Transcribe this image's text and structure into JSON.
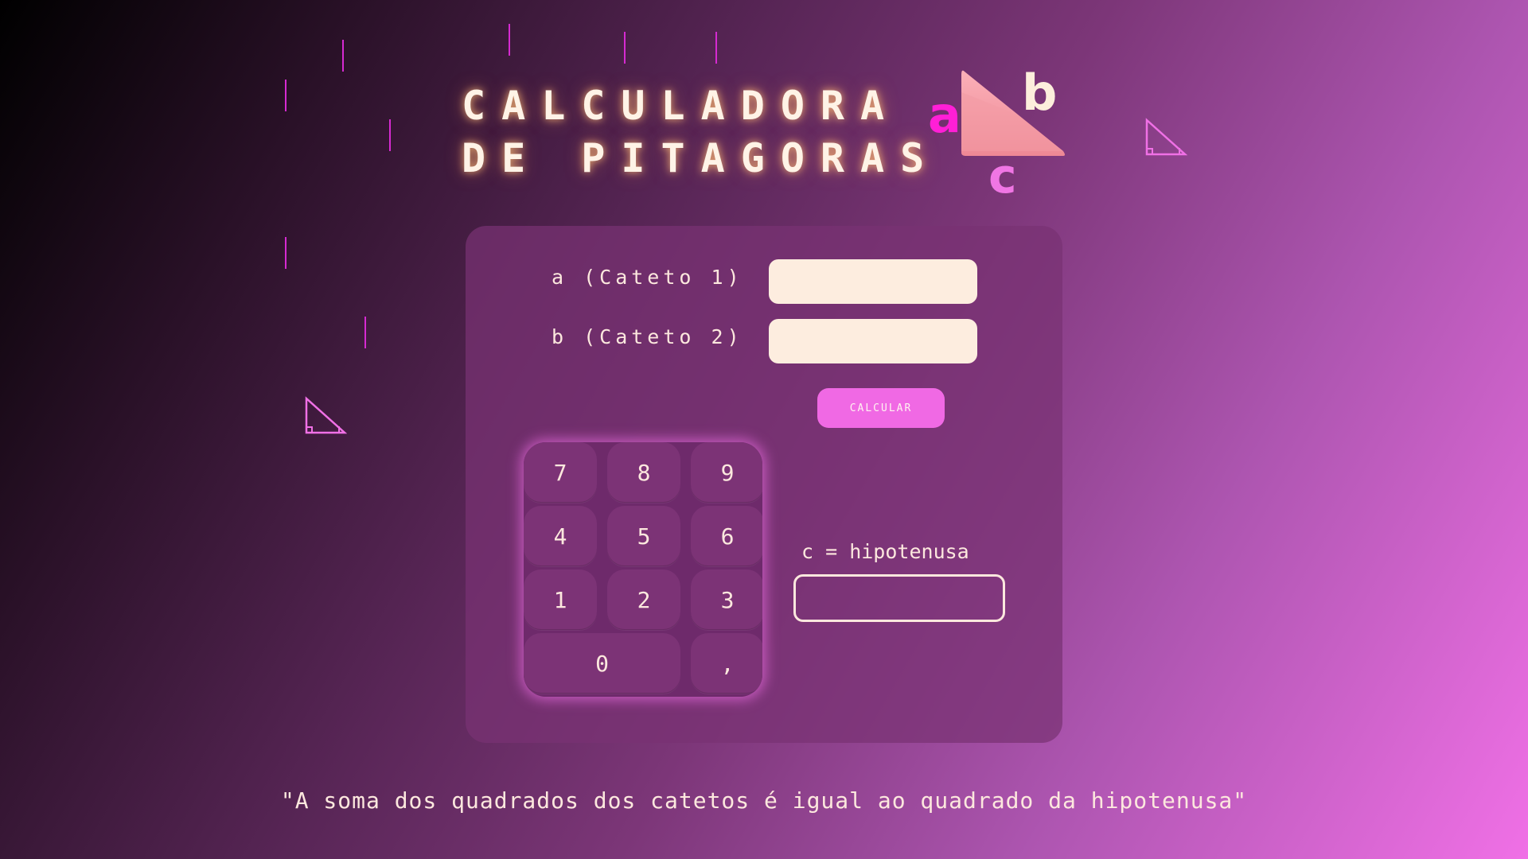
{
  "title": {
    "line1": "CALCULADORA",
    "line2": "DE PITAGORAS"
  },
  "logo": {
    "letter_a": "a",
    "letter_b": "b",
    "letter_c": "c",
    "color_a": "#ff1fd6",
    "color_b": "#fdeedc",
    "color_c": "#f076e4",
    "triangle_color": "#f08a9a"
  },
  "form": {
    "a_label": "a (Cateto 1)",
    "a_value": "",
    "b_label": "b (Cateto 2)",
    "b_value": "",
    "calculate_label": "CALCULAR"
  },
  "keypad": {
    "keys": [
      "7",
      "8",
      "9",
      "4",
      "5",
      "6",
      "1",
      "2",
      "3",
      "0",
      ","
    ]
  },
  "result": {
    "label": "c = hipotenusa",
    "value": ""
  },
  "quote": "\"A soma dos quadrados dos catetos é igual ao quadrado da hipotenusa\"",
  "colors": {
    "accent": "#f069e4",
    "input_background": "#fdeddf",
    "text": "#fde8de",
    "deco_line": "#d62ad1"
  },
  "icons": [
    "right-triangle-logo-icon",
    "right-triangle-outline-icon"
  ]
}
